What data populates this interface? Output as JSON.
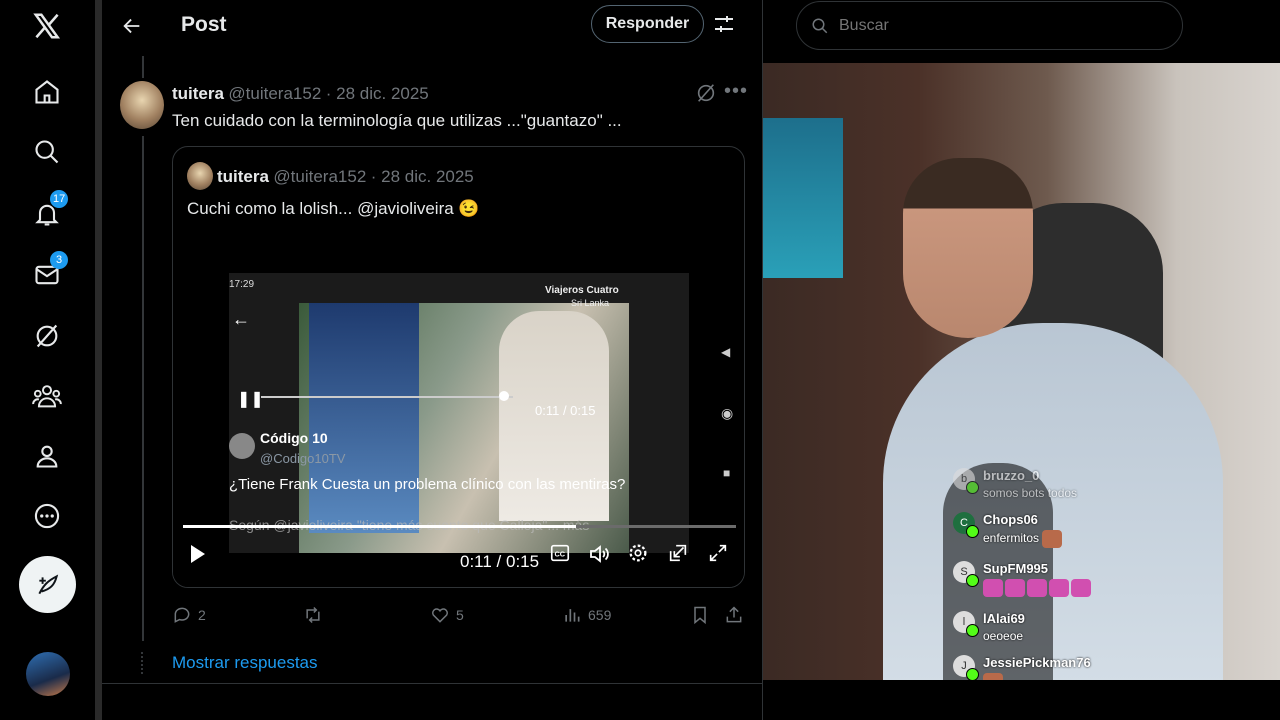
{
  "nav": {
    "notifications_count": "17",
    "messages_count": "3"
  },
  "header": {
    "title": "Post",
    "reply_label": "Responder"
  },
  "tweet": {
    "name": "tuitera",
    "handle": "@tuitera152",
    "date": "· 28 dic. 2025",
    "text": "Ten cuidado con la terminología que utilizas ...\"guantazo\" ...",
    "quote": {
      "name": "tuitera",
      "handle": "@tuitera152",
      "date": "· 28 dic. 2025",
      "text": "Cuchi como la lolish... @javioliveira 😉",
      "video": {
        "phone_time": "17:29",
        "inner_time": "0:11 / 0:15",
        "inner_account": "Código 10",
        "inner_handle": "@Codigo10TV",
        "inner_text": "¿Tiene Frank Cuesta un problema clínico con las mentiras?",
        "inner_text2": "Según @javioliveira \"tiene más cuento que Calleja\"... más",
        "overlay_channel": "Viajeros Cuatro",
        "overlay_place": "Sri Lanka",
        "time": "0:11 / 0:15",
        "progress": 0.71
      }
    },
    "actions": {
      "replies": "2",
      "likes": "5",
      "views": "659"
    },
    "show_replies": "Mostrar respuestas"
  },
  "search": {
    "placeholder": "Buscar"
  },
  "chat": [
    {
      "initial": "b",
      "name": "bruzzo_0",
      "message": "somos bots todos"
    },
    {
      "initial": "C",
      "name": "Chops06",
      "message": "enfermitos"
    },
    {
      "initial": "S",
      "name": "SupFM995",
      "message": ""
    },
    {
      "initial": "l",
      "name": "lAlai69",
      "message": "oeoeoe"
    },
    {
      "initial": "J",
      "name": "JessiePickman76",
      "message": ""
    }
  ]
}
